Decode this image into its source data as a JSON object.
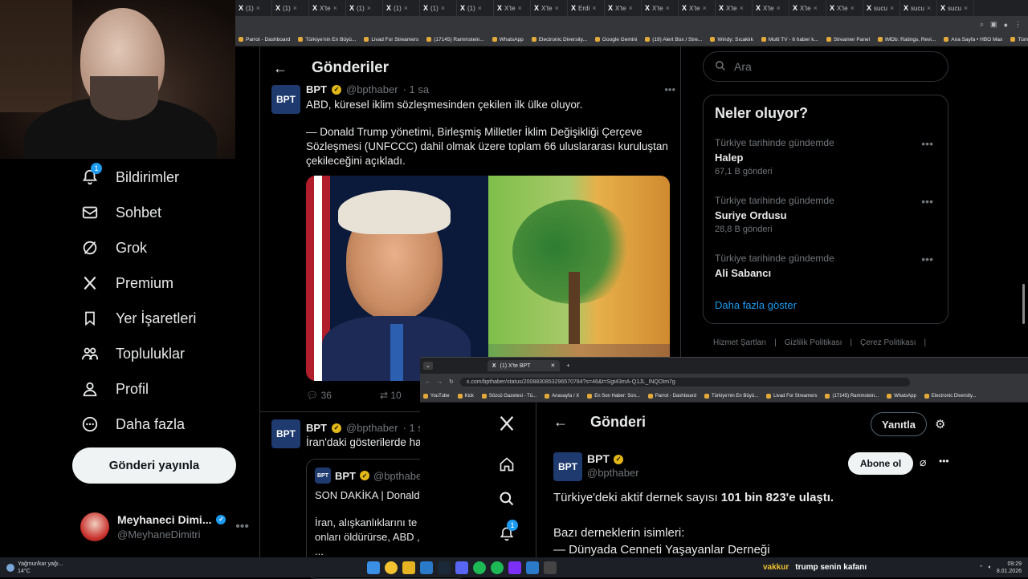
{
  "browser": {
    "tabs": [
      "(1)",
      "(1)",
      "X'te",
      "(1)",
      "(1)",
      "(1)",
      "(1)",
      "X'te",
      "X'te",
      "Erdi",
      "X'te",
      "X'te",
      "X'te",
      "X'te",
      "X'te",
      "X'te",
      "X'te",
      "sucu",
      "sucu",
      "sucu"
    ],
    "bookmarks": [
      "Parrot - Dashboard",
      "Türkiye'nin En Büyü...",
      "Livad For Streamers",
      "(17145) Rammstein...",
      "WhatsApp",
      "Electronic Diversity...",
      "Google Gemini",
      "(19) Alert Box / Stre...",
      "Windy: Sıcaklık",
      "Multi TV - 6 haber k...",
      "Streamer Panel",
      "IMDb: Ratings, Revi...",
      "Ana Sayfa • HBO Max",
      "Tüm Yer İşaretleri"
    ]
  },
  "nav": {
    "items": [
      {
        "label": "Bildirimler",
        "badge": "1"
      },
      {
        "label": "Sohbet"
      },
      {
        "label": "Grok"
      },
      {
        "label": "Premium"
      },
      {
        "label": "Yer İşaretleri"
      },
      {
        "label": "Topluluklar"
      },
      {
        "label": "Profil"
      },
      {
        "label": "Daha fazla"
      }
    ],
    "post_button": "Gönderi yayınla",
    "account": {
      "name": "Meyhaneci Dimi...",
      "handle": "@MeyhaneDimitri"
    }
  },
  "main": {
    "header": "Gönderiler",
    "tweet1": {
      "avatar": "BPT",
      "name": "BPT",
      "handle": "@bpthaber",
      "time": "· 1 sa",
      "line1": "ABD, küresel iklim sözleşmesinden çekilen ilk ülke oluyor.",
      "line2": "— Donald Trump yönetimi, Birleşmiş Milletler İklim Değişikliği Çerçeve Sözleşmesi (UNFCCC) dahil olmak üzere toplam 66 uluslararası kuruluştan çekileceğini açıkladı.",
      "replies": "36",
      "reposts": "10"
    },
    "tweet2": {
      "avatar": "BPT",
      "name": "BPT",
      "handle": "@bpthaber",
      "time": "· 1 sa",
      "text": "İran'daki gösterilerde ha",
      "quote_name": "BPT",
      "quote_handle": "@bpthaber",
      "quote_l1": "SON DAKİKA | Donald",
      "quote_l2": "İran, alışkanlıklarını te",
      "quote_l3": "onları öldürürse, ABD ,",
      "quote_l4": "..."
    }
  },
  "sidebar": {
    "search_placeholder": "Ara",
    "trends_title": "Neler oluyor?",
    "trends": [
      {
        "context": "Türkiye tarihinde gündemde",
        "name": "Halep",
        "count": "67,1 B gönderi"
      },
      {
        "context": "Türkiye tarihinde gündemde",
        "name": "Suriye Ordusu",
        "count": "28,8 B gönderi"
      },
      {
        "context": "Türkiye tarihinde gündemde",
        "name": "Ali Sabancı",
        "count": ""
      }
    ],
    "show_more": "Daha fazla göster",
    "footer": [
      "Hizmet Şartları",
      "Gizlilik Politikası",
      "Çerez Politikası"
    ]
  },
  "window2": {
    "tab_title": "(1) X'te BPT",
    "url": "x.com/bpthaber/status/2008830853296570784?s=46&t=Sgt43mA-Q1JL_INQOIm7g",
    "bookmarks": [
      "YouTube",
      "Kick",
      "Sözcü Gazetesi - Tü...",
      "Anasayfa / X",
      "En Son Haber: Son...",
      "Parrot - Dashboard",
      "Türkiye'nin En Büyü...",
      "Livad For Streamers",
      "(17145) Rammstein...",
      "WhatsApp",
      "Electronic Diversity..."
    ],
    "header": "Gönderi",
    "reply_button": "Yanıtla",
    "follow_button": "Abone ol",
    "notif_badge": "1",
    "post": {
      "avatar": "BPT",
      "name": "BPT",
      "handle": "@bpthaber",
      "text_pre": "Türkiye'deki aktif dernek sayısı ",
      "text_bold": "101 bin 823'e ulaştı.",
      "line2": "Bazı derneklerin isimleri:",
      "line3": "— Dünyada Cenneti Yaşayanlar Derneği"
    }
  },
  "taskbar": {
    "weather": "Yağmur/kar yağı...",
    "temp": "14°C",
    "chat_user": "vakkur",
    "chat_msg": "trump senin kafanı",
    "time": "09:29",
    "date": "8.01.2026"
  },
  "colors": {
    "accent": "#1d9bf0",
    "gold_badge": "#e2b719",
    "bg": "#000000",
    "border": "#2f3336"
  }
}
